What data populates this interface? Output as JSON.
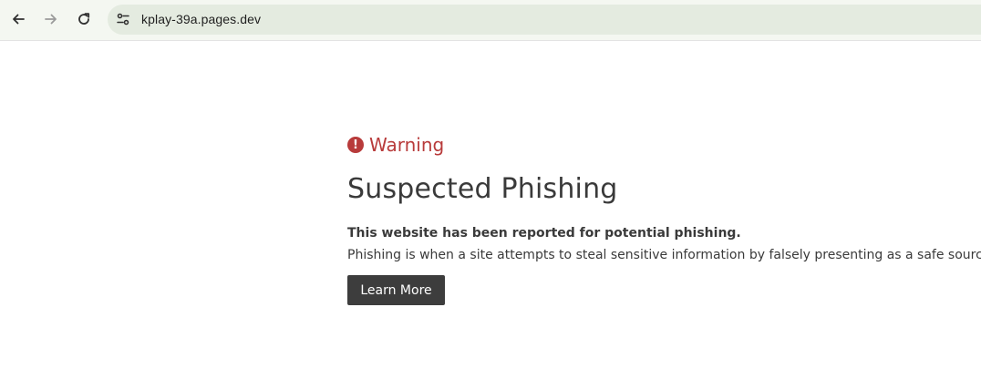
{
  "browser": {
    "url": "kplay-39a.pages.dev",
    "nav": {
      "back_icon": "arrow-left-icon",
      "forward_icon": "arrow-right-icon",
      "reload_icon": "reload-icon",
      "site_info_icon": "tune-icon"
    }
  },
  "warning": {
    "icon": "exclamation-circle-icon",
    "icon_glyph": "!",
    "label": "Warning",
    "color": "#b83b3b"
  },
  "page": {
    "title": "Suspected Phishing",
    "lead": "This website has been reported for potential phishing.",
    "description": "Phishing is when a site attempts to steal sensitive information by falsely presenting as a safe source.",
    "learn_more_label": "Learn More"
  }
}
